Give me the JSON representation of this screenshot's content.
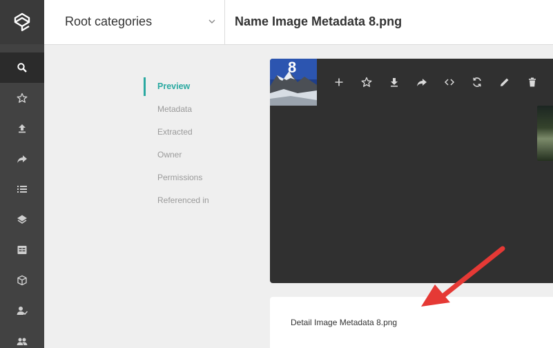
{
  "sidebar": {
    "logo": "app-logo",
    "items": [
      {
        "name": "search",
        "icon": "search-icon",
        "active": true
      },
      {
        "name": "favorites",
        "icon": "star-icon",
        "active": false
      },
      {
        "name": "upload",
        "icon": "upload-icon",
        "active": false
      },
      {
        "name": "share",
        "icon": "share-icon",
        "active": false
      },
      {
        "name": "list",
        "icon": "list-icon",
        "active": false
      },
      {
        "name": "layers",
        "icon": "layers-icon",
        "active": false
      },
      {
        "name": "board",
        "icon": "board-icon",
        "active": false
      },
      {
        "name": "cube",
        "icon": "cube-icon",
        "active": false
      },
      {
        "name": "user-check",
        "icon": "user-check-icon",
        "active": false
      },
      {
        "name": "users",
        "icon": "users-icon",
        "active": false
      }
    ]
  },
  "header": {
    "category_label": "Root categories",
    "title": "Name Image Metadata 8.png"
  },
  "sections": [
    {
      "label": "Preview",
      "active": true
    },
    {
      "label": "Metadata",
      "active": false
    },
    {
      "label": "Extracted",
      "active": false
    },
    {
      "label": "Owner",
      "active": false
    },
    {
      "label": "Permissions",
      "active": false
    },
    {
      "label": "Referenced in",
      "active": false
    }
  ],
  "preview": {
    "thumbnail_number": "8",
    "toolbar": [
      "add-icon",
      "star-icon",
      "download-icon",
      "share-icon",
      "embed-code-icon",
      "refresh-icon",
      "edit-icon",
      "delete-icon",
      "more-icon"
    ]
  },
  "detail": {
    "text": "Detail Image Metadata 8.png"
  },
  "colors": {
    "accent": "#2aa9a1",
    "sidebar_bg": "#424242",
    "preview_bg": "#303030",
    "annotation_arrow": "#e53935"
  }
}
